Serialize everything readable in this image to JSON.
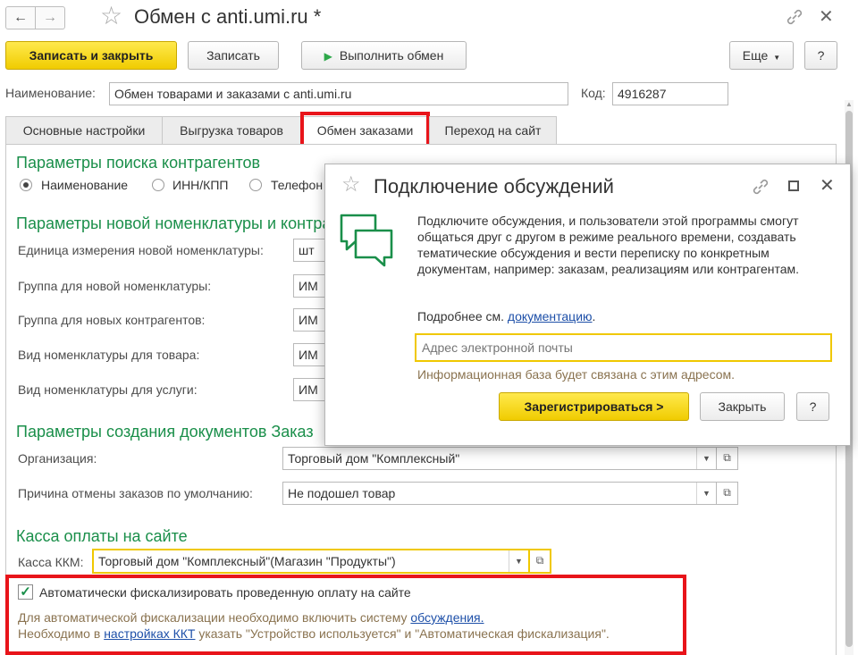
{
  "window": {
    "title": "Обмен с anti.umi.ru *"
  },
  "toolbar": {
    "save_close": "Записать и закрыть",
    "save": "Записать",
    "run_exchange": "Выполнить обмен",
    "more": "Еще",
    "help": "?"
  },
  "header": {
    "name_label": "Наименование:",
    "name_value": "Обмен товарами и заказами с anti.umi.ru",
    "code_label": "Код:",
    "code_value": "4916287"
  },
  "tabs": [
    "Основные настройки",
    "Выгрузка товаров",
    "Обмен заказами",
    "Переход на сайт"
  ],
  "search": {
    "title": "Параметры поиска контрагентов",
    "options": [
      "Наименование",
      "ИНН/КПП",
      "Телефон"
    ]
  },
  "nomenclature": {
    "title": "Параметры новой номенклатуры и контрагентов",
    "rows": [
      {
        "label": "Единица измерения новой номенклатуры:",
        "value": "шт"
      },
      {
        "label": "Группа для новой номенклатуры:",
        "value": "ИМ"
      },
      {
        "label": "Группа для новых контрагентов:",
        "value": "ИМ"
      },
      {
        "label": "Вид номенклатуры для товара:",
        "value": "ИМ"
      },
      {
        "label": "Вид номенклатуры для услуги:",
        "value": "ИМ"
      }
    ]
  },
  "docs": {
    "title": "Параметры создания документов Заказ",
    "org_label": "Организация:",
    "org_value": "Торговый дом \"Комплексный\"",
    "cancel_label": "Причина отмены заказов по умолчанию:",
    "cancel_value": "Не подошел товар"
  },
  "kassa": {
    "title": "Касса оплаты на сайте",
    "kkm_label": "Касса ККМ:",
    "kkm_value": "Торговый дом \"Комплексный\"(Магазин \"Продукты\")",
    "auto_label": "Автоматически фискализировать проведенную оплату на сайте",
    "auto_checked": true,
    "note1_text": "Для автоматической фискализации необходимо включить систему ",
    "note1_link": "обсуждения.",
    "note2_pre": "Необходимо в ",
    "note2_link": "настройках ККТ",
    "note2_post": " указать \"Устройство используется\" и \"Автоматическая фискализация\"."
  },
  "dialog": {
    "title": "Подключение обсуждений",
    "text": "Подключите обсуждения, и пользователи этой программы смогут общаться друг с другом в режиме реального времени, создавать тематические обсуждения и вести переписку по конкретным документам, например: заказам, реализациям или контрагентам.",
    "more_text": "Подробнее см. ",
    "more_link": "документацию",
    "more_end": ".",
    "email_placeholder": "Адрес электронной почты",
    "hint": "Информационная база будет связана с этим адресом.",
    "register": "Зарегистрироваться >",
    "close": "Закрыть",
    "help": "?"
  },
  "colors": {
    "accent_green": "#1a8f4a",
    "highlight_red": "#e8141a",
    "button_yellow": "#f5d800",
    "link_blue": "#1d4fa8"
  }
}
